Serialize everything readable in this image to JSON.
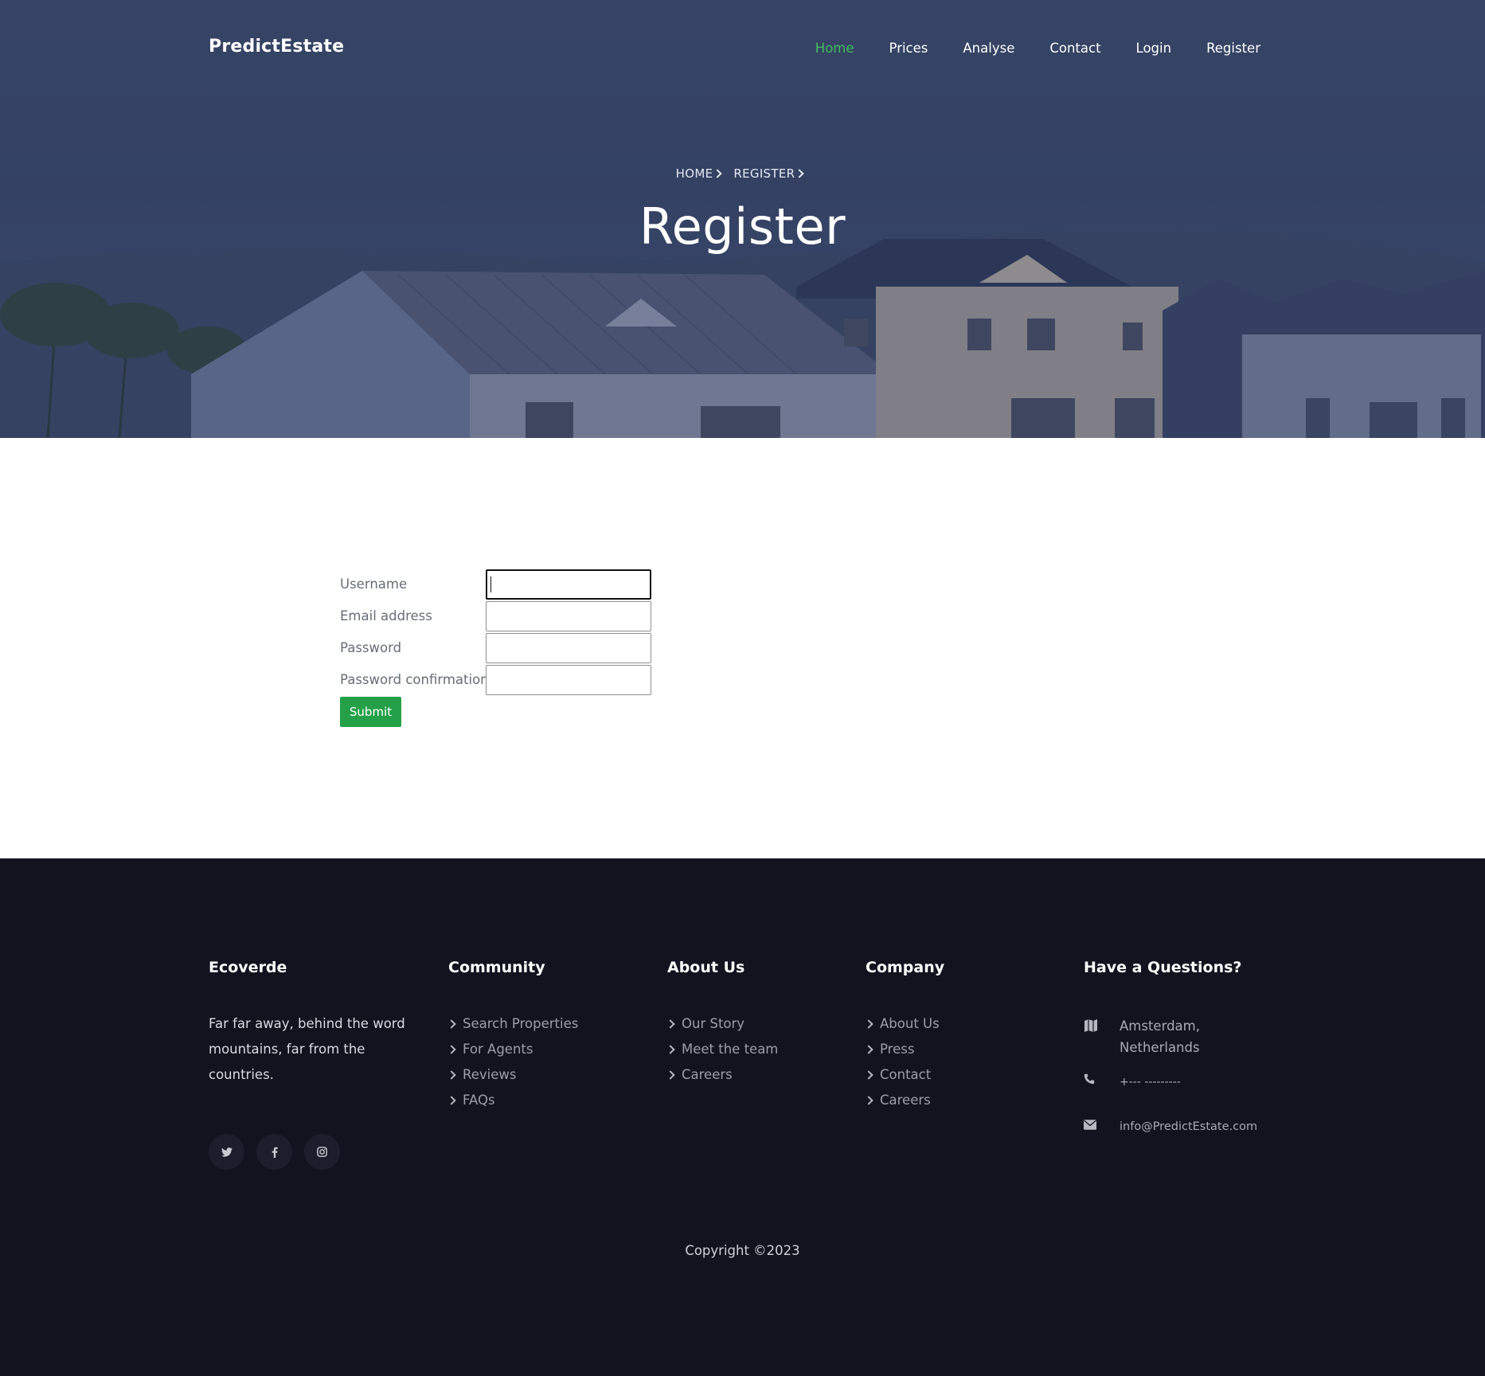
{
  "brand": "PredictEstate",
  "nav": {
    "items": [
      {
        "label": "Home",
        "active": true
      },
      {
        "label": "Prices"
      },
      {
        "label": "Analyse"
      },
      {
        "label": "Contact"
      },
      {
        "label": "Login"
      },
      {
        "label": "Register"
      }
    ],
    "active_color": "#3fbf5b"
  },
  "hero": {
    "breadcrumb": [
      "HOME",
      "REGISTER"
    ],
    "title": "Register"
  },
  "form": {
    "fields": [
      {
        "label": "Username",
        "value": "",
        "focused": true
      },
      {
        "label": "Email address",
        "value": ""
      },
      {
        "label": "Password",
        "value": ""
      },
      {
        "label": "Password confirmation",
        "value": ""
      }
    ],
    "submit_label": "Submit",
    "submit_color": "#24a148"
  },
  "footer": {
    "ecoverde": {
      "title": "Ecoverde",
      "text": "Far far away, behind the word mountains, far from the countries."
    },
    "community": {
      "title": "Community",
      "links": [
        "Search Properties",
        "For Agents",
        "Reviews",
        "FAQs"
      ]
    },
    "about": {
      "title": "About Us",
      "links": [
        "Our Story",
        "Meet the team",
        "Careers"
      ]
    },
    "company": {
      "title": "Company",
      "links": [
        "About Us",
        "Press",
        "Contact",
        "Careers"
      ]
    },
    "questions": {
      "title": "Have a Questions?",
      "address": "Amsterdam, Netherlands",
      "phone": "+--- ---------",
      "email": "info@PredictEstate.com"
    },
    "social": [
      "twitter-icon",
      "facebook-icon",
      "instagram-icon"
    ],
    "copyright": "Copyright ©2023",
    "background": "#12131f"
  }
}
